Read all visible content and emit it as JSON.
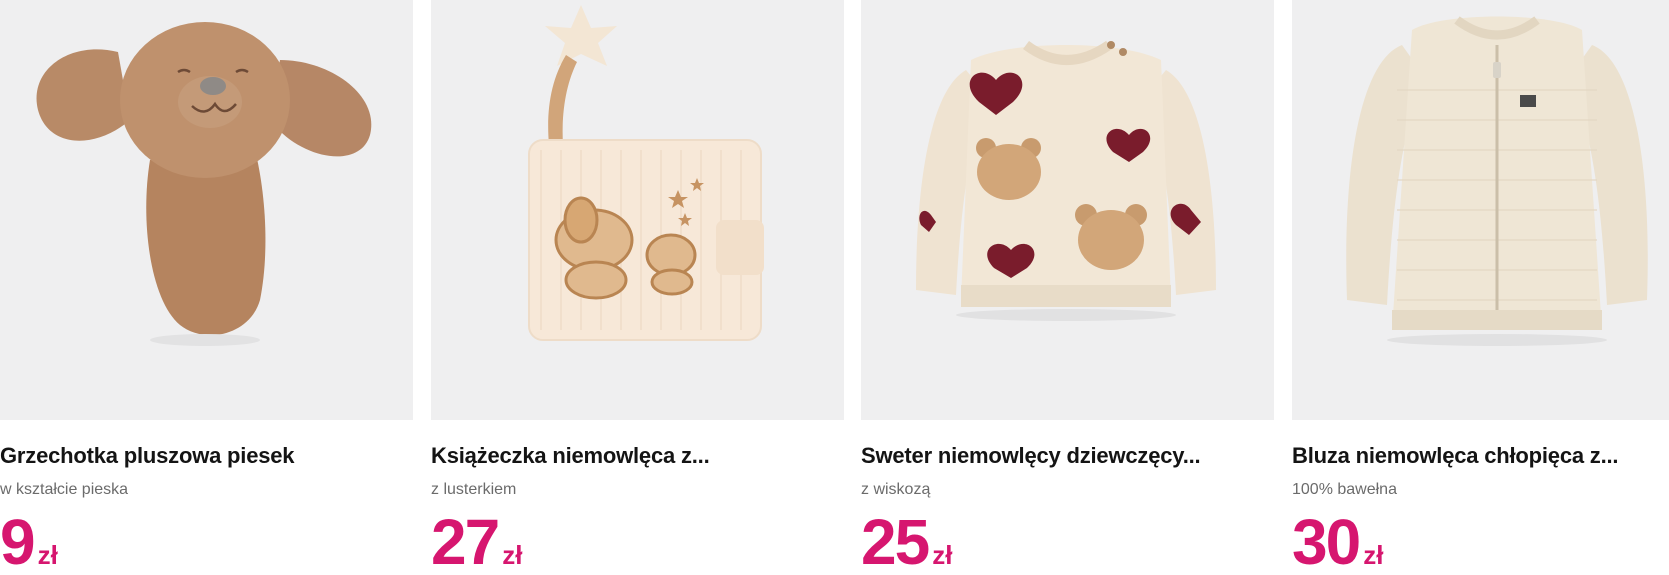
{
  "products": [
    {
      "title": "Grzechotka pluszowa piesek",
      "subtitle": "w kształcie pieska",
      "price": "9",
      "currency": "zł",
      "image": "plush-dog-rattle-image"
    },
    {
      "title": "Książeczka niemowlęca z...",
      "subtitle": "z lusterkiem",
      "price": "27",
      "currency": "zł",
      "image": "soft-baby-book-image"
    },
    {
      "title": "Sweter niemowlęcy dziewczęcy...",
      "subtitle": "z wiskozą",
      "price": "25",
      "currency": "zł",
      "image": "baby-sweater-image"
    },
    {
      "title": "Bluza niemowlęca chłopięca z...",
      "subtitle": "100% bawełna",
      "price": "30",
      "currency": "zł",
      "image": "zip-cardigan-image"
    }
  ],
  "colors": {
    "price": "#d6166f",
    "image_background": "#efeff0",
    "title": "#141414",
    "subtitle": "#6b6b6b"
  }
}
